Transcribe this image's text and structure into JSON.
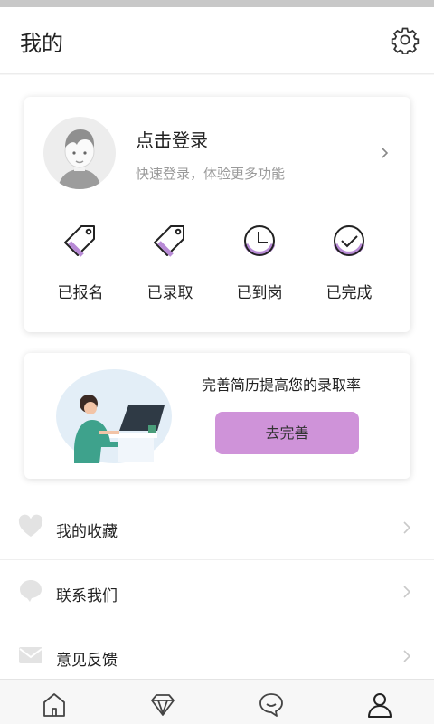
{
  "header": {
    "title": "我的",
    "settings_icon": "gear-icon"
  },
  "profile": {
    "login_title": "点击登录",
    "login_subtitle": "快速登录，体验更多功能",
    "avatar_icon": "default-avatar",
    "arrow_icon": "chevron-right-icon"
  },
  "status": [
    {
      "label": "已报名",
      "icon": "tag-icon"
    },
    {
      "label": "已录取",
      "icon": "tag-icon"
    },
    {
      "label": "已到岗",
      "icon": "clock-icon"
    },
    {
      "label": "已完成",
      "icon": "check-circle-icon"
    }
  ],
  "resume": {
    "text": "完善简历提高您的录取率",
    "button_label": "去完善",
    "button_color": "#cf93d9"
  },
  "menu": [
    {
      "label": "我的收藏",
      "icon": "heart-icon"
    },
    {
      "label": "联系我们",
      "icon": "chat-bubble-icon"
    },
    {
      "label": "意见反馈",
      "icon": "mail-icon"
    }
  ],
  "tabbar": [
    {
      "icon": "home-icon"
    },
    {
      "icon": "diamond-icon"
    },
    {
      "icon": "message-icon"
    },
    {
      "icon": "user-icon",
      "active": true
    }
  ],
  "colors": {
    "accent": "#cf93d9",
    "icon_stroke": "#222222",
    "icon_accent": "#b88ad6"
  }
}
